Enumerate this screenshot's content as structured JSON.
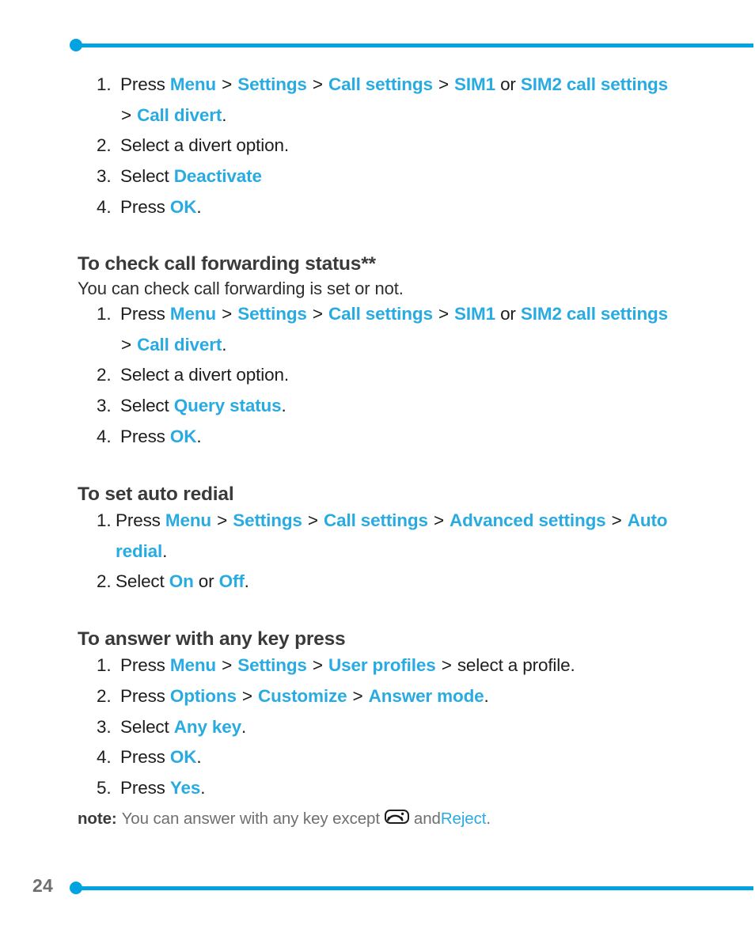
{
  "page": {
    "number": "24",
    "accent_color": "#29abe2",
    "rule_color": "#00a3e2",
    "text_color": "#1d1d1d",
    "muted_color": "#6f6f6f"
  },
  "sections": [
    {
      "id": "deactivate-call-forwarding",
      "heading": null,
      "intro": null,
      "steps": [
        {
          "num": "1.",
          "line1": [
            {
              "t": "Press ",
              "style": "plain"
            },
            {
              "t": "Menu",
              "style": "key"
            },
            {
              "t": ">",
              "style": "gt"
            },
            {
              "t": "Settings",
              "style": "key"
            },
            {
              "t": ">",
              "style": "gt"
            },
            {
              "t": "Call settings",
              "style": "key"
            },
            {
              "t": ">",
              "style": "gt"
            },
            {
              "t": "SIM1",
              "style": "key"
            },
            {
              "t": " or ",
              "style": "plain"
            },
            {
              "t": "SIM2 call settings",
              "style": "key"
            }
          ],
          "line2": [
            {
              "t": ">",
              "style": "gt"
            },
            {
              "t": "Call divert",
              "style": "key"
            },
            {
              "t": ".",
              "style": "plain"
            }
          ]
        },
        {
          "num": "2.",
          "line1": [
            {
              "t": "Select a divert option.",
              "style": "plain"
            }
          ]
        },
        {
          "num": "3.",
          "line1": [
            {
              "t": "Select ",
              "style": "plain"
            },
            {
              "t": "Deactivate",
              "style": "key"
            }
          ]
        },
        {
          "num": "4.",
          "line1": [
            {
              "t": "Press ",
              "style": "plain"
            },
            {
              "t": "OK",
              "style": "key"
            },
            {
              "t": ".",
              "style": "plain"
            }
          ]
        }
      ]
    },
    {
      "id": "check-call-forwarding-status",
      "heading": "To check call forwarding status**",
      "intro": "You can check call forwarding is set or not.",
      "steps": [
        {
          "num": "1.",
          "line1": [
            {
              "t": "Press ",
              "style": "plain"
            },
            {
              "t": "Menu",
              "style": "key"
            },
            {
              "t": ">",
              "style": "gt"
            },
            {
              "t": "Settings",
              "style": "key"
            },
            {
              "t": ">",
              "style": "gt"
            },
            {
              "t": "Call settings",
              "style": "key"
            },
            {
              "t": ">",
              "style": "gt"
            },
            {
              "t": "SIM1",
              "style": "key"
            },
            {
              "t": " or ",
              "style": "plain"
            },
            {
              "t": "SIM2 call settings",
              "style": "key"
            }
          ],
          "line2": [
            {
              "t": ">",
              "style": "gt"
            },
            {
              "t": "Call divert",
              "style": "key"
            },
            {
              "t": ".",
              "style": "plain"
            }
          ]
        },
        {
          "num": "2.",
          "line1": [
            {
              "t": "Select a divert option.",
              "style": "plain"
            }
          ]
        },
        {
          "num": "3.",
          "line1": [
            {
              "t": "Select ",
              "style": "plain"
            },
            {
              "t": "Query status",
              "style": "key"
            },
            {
              "t": ".",
              "style": "plain"
            }
          ]
        },
        {
          "num": "4.",
          "line1": [
            {
              "t": "Press ",
              "style": "plain"
            },
            {
              "t": "OK",
              "style": "key"
            },
            {
              "t": ".",
              "style": "plain"
            }
          ]
        }
      ]
    },
    {
      "id": "set-auto-redial",
      "heading": "To set auto redial",
      "intro": null,
      "tight": true,
      "steps": [
        {
          "num": "1.",
          "line1": [
            {
              "t": "Press ",
              "style": "plain"
            },
            {
              "t": "Menu",
              "style": "key"
            },
            {
              "t": ">",
              "style": "gt"
            },
            {
              "t": "Settings",
              "style": "key"
            },
            {
              "t": ">",
              "style": "gt"
            },
            {
              "t": "Call settings",
              "style": "key"
            },
            {
              "t": ">",
              "style": "gt"
            },
            {
              "t": "Advanced settings",
              "style": "key"
            },
            {
              "t": ">",
              "style": "gt"
            },
            {
              "t": "Auto",
              "style": "key"
            }
          ],
          "line2": [
            {
              "t": "redial",
              "style": "key"
            },
            {
              "t": ".",
              "style": "plain"
            }
          ]
        },
        {
          "num": "2.",
          "line1": [
            {
              "t": "Select ",
              "style": "plain"
            },
            {
              "t": "On",
              "style": "key"
            },
            {
              "t": " or ",
              "style": "plain"
            },
            {
              "t": "Off",
              "style": "key"
            },
            {
              "t": ".",
              "style": "plain"
            }
          ]
        }
      ]
    },
    {
      "id": "answer-with-any-key-press",
      "heading": "To answer with any key press",
      "intro": null,
      "steps": [
        {
          "num": "1.",
          "line1": [
            {
              "t": "Press ",
              "style": "plain"
            },
            {
              "t": "Menu",
              "style": "key"
            },
            {
              "t": ">",
              "style": "gt"
            },
            {
              "t": "Settings",
              "style": "key"
            },
            {
              "t": ">",
              "style": "gt"
            },
            {
              "t": "User profiles",
              "style": "key"
            },
            {
              "t": ">",
              "style": "gt"
            },
            {
              "t": "select a profile.",
              "style": "plain"
            }
          ]
        },
        {
          "num": "2.",
          "line1": [
            {
              "t": "Press ",
              "style": "plain"
            },
            {
              "t": "Options",
              "style": "key"
            },
            {
              "t": ">",
              "style": "gt"
            },
            {
              "t": "Customize",
              "style": "key"
            },
            {
              "t": ">",
              "style": "gt"
            },
            {
              "t": "Answer mode",
              "style": "key"
            },
            {
              "t": ".",
              "style": "plain"
            }
          ]
        },
        {
          "num": "3.",
          "line1": [
            {
              "t": "Select ",
              "style": "plain"
            },
            {
              "t": "Any key",
              "style": "key"
            },
            {
              "t": ".",
              "style": "plain"
            }
          ]
        },
        {
          "num": "4.",
          "line1": [
            {
              "t": "Press ",
              "style": "plain"
            },
            {
              "t": "OK",
              "style": "key"
            },
            {
              "t": ".",
              "style": "plain"
            }
          ]
        },
        {
          "num": "5.",
          "line1": [
            {
              "t": "Press ",
              "style": "plain"
            },
            {
              "t": "Yes",
              "style": "key"
            },
            {
              "t": ".",
              "style": "plain"
            }
          ]
        }
      ],
      "note": {
        "label": "note:",
        "before_icon": "You can answer with any key except",
        "icon": "end-call-key-icon",
        "after_icon": "and",
        "accent": "Reject",
        "end": "."
      }
    }
  ]
}
